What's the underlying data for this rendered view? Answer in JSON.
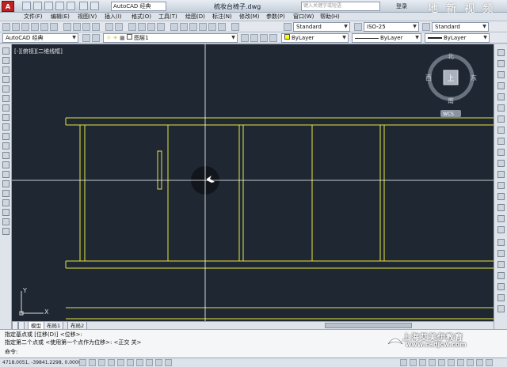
{
  "titlebar": {
    "workspace": "AutoCAD 经典",
    "doc_title": "梳妆台椅子.dwg",
    "search_placeholder": "键入关键字或短语",
    "login": "登录",
    "watermark": "地 新 视 频"
  },
  "menu": [
    "文件(F)",
    "编辑(E)",
    "视图(V)",
    "插入(I)",
    "格式(O)",
    "工具(T)",
    "绘图(D)",
    "标注(N)",
    "修改(M)",
    "参数(P)",
    "窗口(W)",
    "帮助(H)"
  ],
  "toolbar1": {
    "text_style": "Standard",
    "dim_style": "ISO-25",
    "table_style": "Standard"
  },
  "toolbar2": {
    "workspace": "AutoCAD 经典",
    "layer": "图层1",
    "color": "ByLayer",
    "linetype": "ByLayer",
    "lineweight": "ByLayer"
  },
  "viewport": {
    "label": "[-][俯视][二维线框]"
  },
  "viewcube": {
    "north": "北",
    "south": "南",
    "east": "东",
    "west": "西",
    "top": "上",
    "wcs": "WCS"
  },
  "ucs": {
    "x": "X",
    "y": "Y"
  },
  "layout_tabs": [
    "模型",
    "布局1",
    "布局2"
  ],
  "command": {
    "line1": "指定基点或 [位移(D)] <位移>:",
    "line2": "指定第二个点或 <使用第一个点作为位移>: <正交 关>",
    "prompt": "命令:"
  },
  "status": {
    "coords": "4718.0051, -39841.2298, 0.0000"
  },
  "brand": {
    "line1": "上海艾美伊教育",
    "line2": "www.cadjcw.com"
  },
  "colors": {
    "canvas_bg": "#1f2733",
    "drawing_lines": "#e6e63c",
    "crosshair": "#ffffff"
  }
}
